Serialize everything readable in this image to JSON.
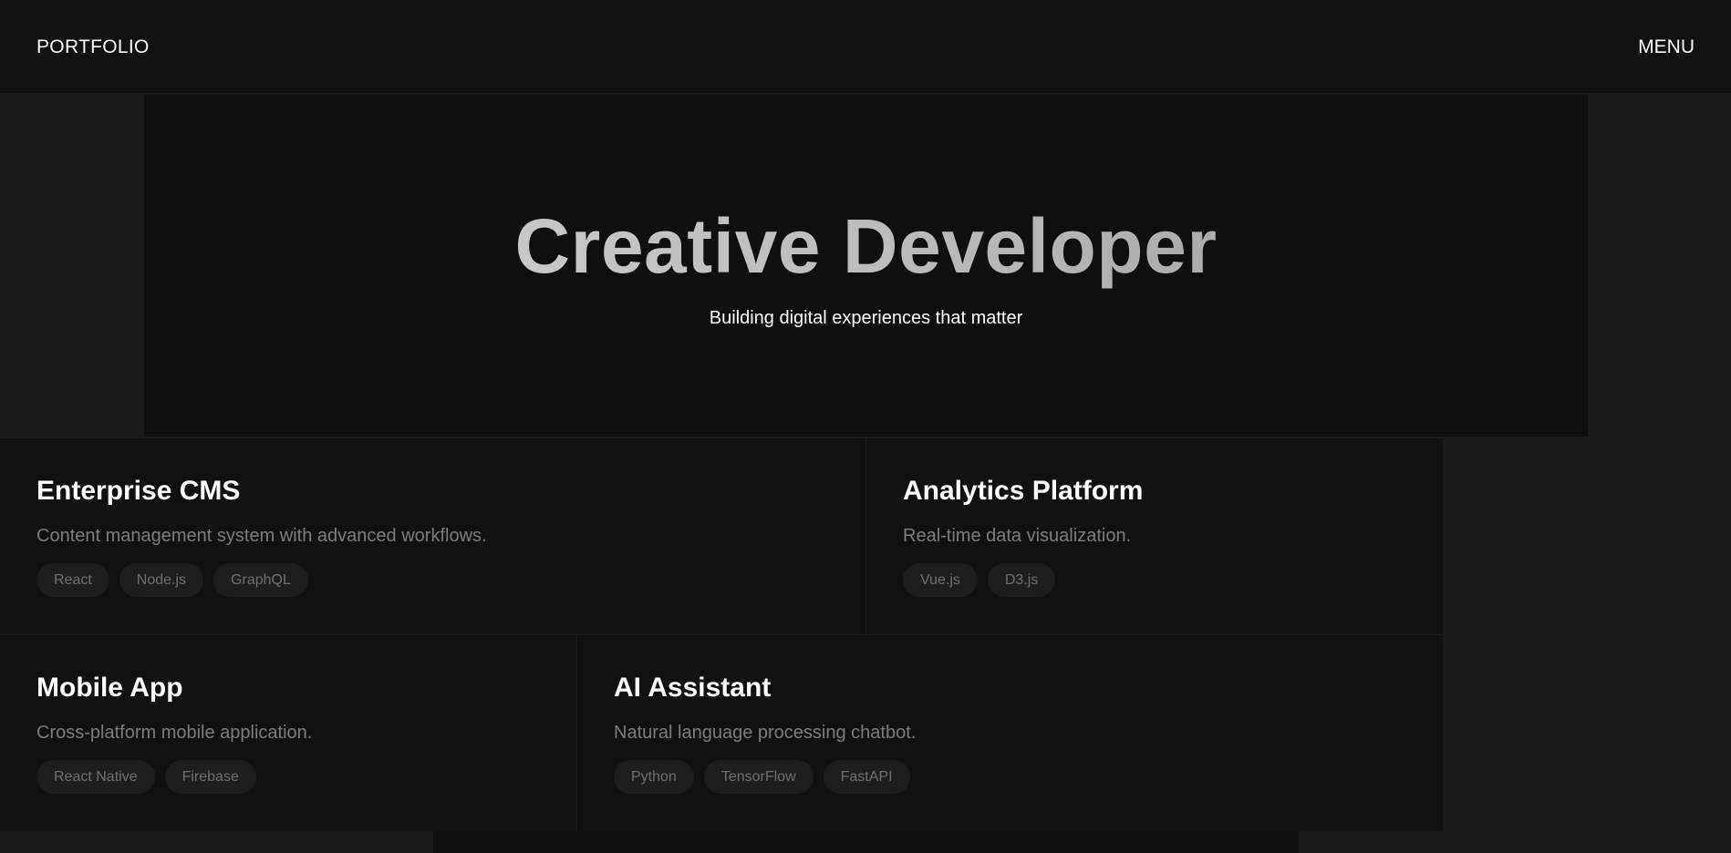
{
  "header": {
    "brand": "PORTFOLIO",
    "menu_label": "MENU"
  },
  "hero": {
    "title": "Creative Developer",
    "subtitle": "Building digital experiences that matter"
  },
  "projects": [
    {
      "title": "Enterprise CMS",
      "description": "Content management system with advanced workflows.",
      "tags": [
        "React",
        "Node.js",
        "GraphQL"
      ]
    },
    {
      "title": "Analytics Platform",
      "description": "Real-time data visualization.",
      "tags": [
        "Vue.js",
        "D3.js"
      ]
    },
    {
      "title": "Mobile App",
      "description": "Cross-platform mobile application.",
      "tags": [
        "React Native",
        "Firebase"
      ]
    },
    {
      "title": "AI Assistant",
      "description": "Natural language processing chatbot.",
      "tags": [
        "Python",
        "TensorFlow",
        "FastAPI"
      ]
    }
  ],
  "colors": {
    "background": "#1b1b1b",
    "panel": "#111111",
    "hero_panel": "#0f0f0f",
    "tag_bg": "#1e1e1e",
    "muted_text": "#7c7c7c"
  }
}
